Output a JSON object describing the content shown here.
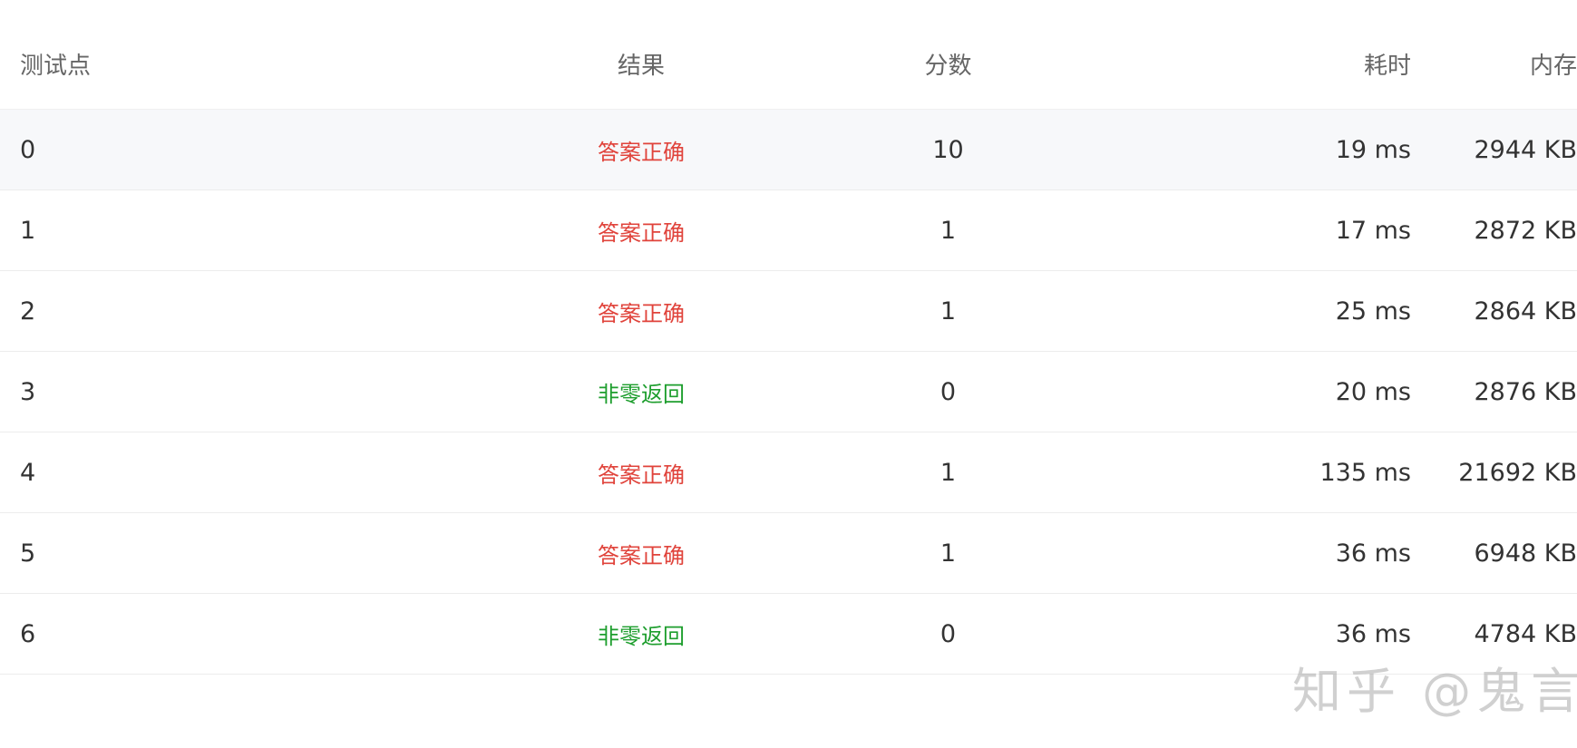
{
  "table": {
    "headers": {
      "case": "测试点",
      "result": "结果",
      "score": "分数",
      "time": "耗时",
      "memory": "内存"
    },
    "rows": [
      {
        "case": "0",
        "result": "答案正确",
        "score": "10",
        "time": "19 ms",
        "memory": "2944 KB"
      },
      {
        "case": "1",
        "result": "答案正确",
        "score": "1",
        "time": "17 ms",
        "memory": "2872 KB"
      },
      {
        "case": "2",
        "result": "答案正确",
        "score": "1",
        "time": "25 ms",
        "memory": "2864 KB"
      },
      {
        "case": "3",
        "result": "非零返回",
        "score": "0",
        "time": "20 ms",
        "memory": "2876 KB"
      },
      {
        "case": "4",
        "result": "答案正确",
        "score": "1",
        "time": "135 ms",
        "memory": "21692 KB"
      },
      {
        "case": "5",
        "result": "答案正确",
        "score": "1",
        "time": "36 ms",
        "memory": "6948 KB"
      },
      {
        "case": "6",
        "result": "非零返回",
        "score": "0",
        "time": "36 ms",
        "memory": "4784 KB"
      }
    ]
  },
  "watermark": "知乎 @鬼言",
  "colors": {
    "accepted": "#e0433b",
    "nonzero_exit": "#1e9e2e",
    "shaded_row": "#f7f8fa"
  }
}
